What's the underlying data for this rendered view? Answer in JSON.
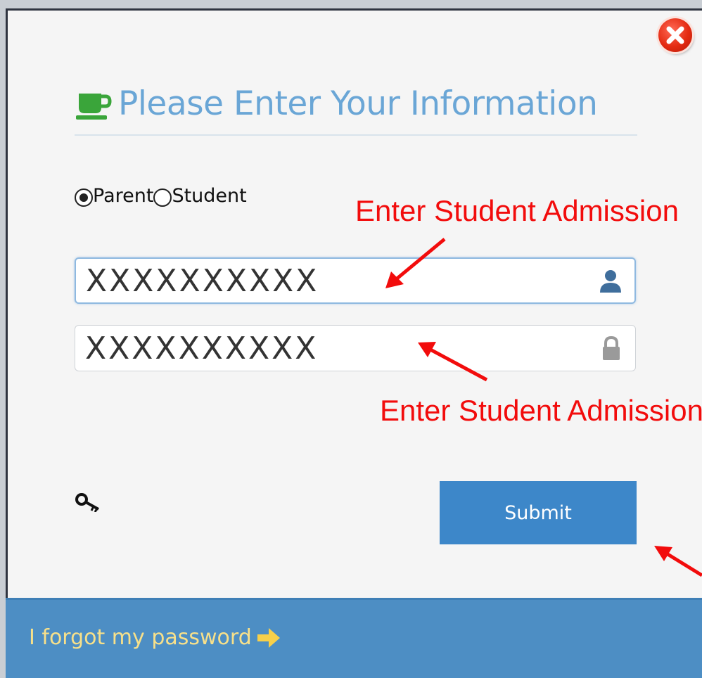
{
  "dialog": {
    "title": "Please Enter Your Information",
    "close_icon": "close-icon"
  },
  "user_type": {
    "options": [
      {
        "label": "Parent",
        "checked": true
      },
      {
        "label": "Student",
        "checked": false
      }
    ]
  },
  "fields": {
    "username_value": "XXXXXXXXXX",
    "password_value": "XXXXXXXXXX",
    "username_icon": "user-icon",
    "password_icon": "lock-icon"
  },
  "annotations": {
    "top": "Enter Student Admission",
    "bottom": "Enter Student Admission"
  },
  "actions": {
    "submit_label": "Submit",
    "key_icon": "key-icon"
  },
  "footer": {
    "forgot_label": "I forgot my password",
    "arrow_icon": "arrow-right-icon"
  },
  "colors": {
    "title": "#6aa6d6",
    "accent": "#3d87c9",
    "footer": "#4d8ec4",
    "link": "#f7e08a",
    "annotation": "#f20c0c"
  }
}
